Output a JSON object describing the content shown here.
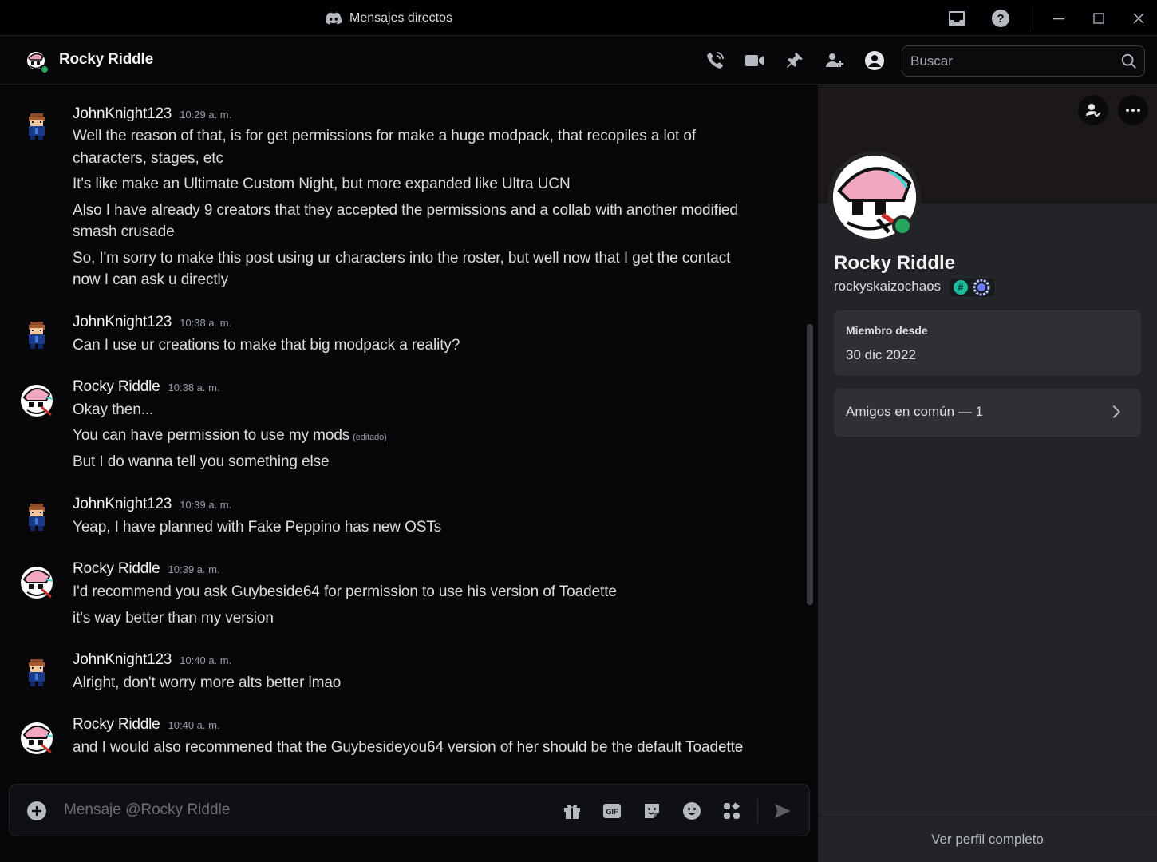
{
  "window": {
    "title": "Mensajes directos"
  },
  "header": {
    "channel_name": "Rocky Riddle",
    "search_placeholder": "Buscar"
  },
  "messages": [
    {
      "author": "JohnKnight123",
      "time": "10:29 a. m.",
      "avatar": "john-avatar",
      "lines": [
        "Well the reason of that, is for get permissions for make a huge modpack, that recopiles a lot of",
        "characters, stages, etc",
        "It's like make an Ultimate Custom Night, but more expanded like Ultra UCN",
        "Also I have already 9 creators that they accepted the permissions and a collab with another modified",
        "smash crusade",
        "So, I'm sorry to make this post using ur characters into the roster, but well now that I get the contact",
        "now I can ask u directly"
      ]
    },
    {
      "author": "JohnKnight123",
      "time": "10:38 a. m.",
      "avatar": "john-avatar",
      "lines": [
        "Can I use ur creations to make that big modpack a reality?"
      ]
    },
    {
      "author": "Rocky Riddle",
      "time": "10:38 a. m.",
      "avatar": "rocky-avatar",
      "lines": [
        "Okay then...",
        "You can have permission to use my mods",
        "But I do wanna tell you something else"
      ],
      "edited_label": "(editado)"
    },
    {
      "author": "JohnKnight123",
      "time": "10:39 a. m.",
      "avatar": "john-avatar",
      "lines": [
        "Yeap, I have planned with Fake Peppino has new OSTs"
      ]
    },
    {
      "author": "Rocky Riddle",
      "time": "10:39 a. m.",
      "avatar": "rocky-avatar",
      "lines": [
        "I'd recommend you ask Guybeside64 for permission to use his version of Toadette",
        "it's way better than my version"
      ]
    },
    {
      "author": "JohnKnight123",
      "time": "10:40 a. m.",
      "avatar": "john-avatar",
      "lines": [
        "Alright, don't worry more alts better lmao"
      ]
    },
    {
      "author": "Rocky Riddle",
      "time": "10:40 a. m.",
      "avatar": "rocky-avatar",
      "lines": [
        "and I would also recommened that the Guybesideyou64 version of her should be the default Toadette"
      ]
    }
  ],
  "composer": {
    "placeholder": "Mensaje @Rocky Riddle",
    "gif_label": "GIF"
  },
  "profile": {
    "display_name": "Rocky Riddle",
    "username": "rockyskaizochaos",
    "badge_hash": "#",
    "member_since_label": "Miembro desde",
    "member_since_value": "30 dic 2022",
    "mutual_friends_label": "Amigos en común — 1",
    "full_profile_label": "Ver perfil completo",
    "status": "online"
  },
  "colors": {
    "online": "#23a55a",
    "panel_bg": "#232428",
    "card_bg": "#2e3035",
    "badge_teal": "#1abc9c"
  }
}
